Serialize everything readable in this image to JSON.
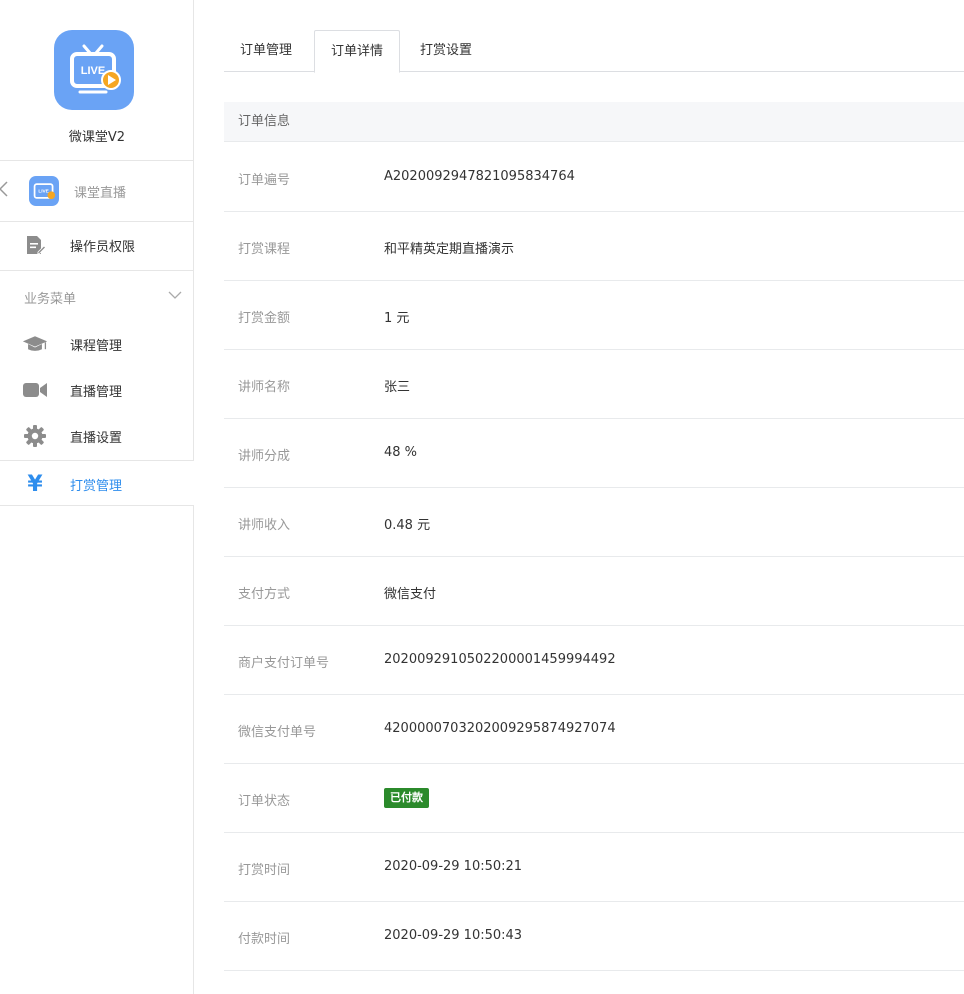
{
  "app": {
    "logo_icon": "live-tv-icon",
    "logo_text": "LIVE",
    "name": "微课堂V2",
    "accent": "#2e8ded",
    "logo_color": "#6aa3f5"
  },
  "sidebar": {
    "back": {
      "icon": "chevron-left-icon",
      "label": "课堂直播"
    },
    "permissions": {
      "icon": "document-edit-icon",
      "label": "操作员权限"
    },
    "group": {
      "title": "业务菜单",
      "icon": "chevron-down-icon"
    },
    "items": [
      {
        "icon": "graduation-cap-icon",
        "label": "课程管理",
        "active": false
      },
      {
        "icon": "video-camera-icon",
        "label": "直播管理",
        "active": false
      },
      {
        "icon": "gear-icon",
        "label": "直播设置",
        "active": false
      },
      {
        "icon": "yen-icon",
        "glyph": "¥",
        "label": "打赏管理",
        "active": true
      }
    ]
  },
  "tabs": [
    {
      "label": "订单管理",
      "active": false
    },
    {
      "label": "订单详情",
      "active": true
    },
    {
      "label": "打赏设置",
      "active": false
    }
  ],
  "section_title": "订单信息",
  "details": [
    {
      "key": "订单遍号",
      "value": "A20200929478210958347​64"
    },
    {
      "key": "打赏课程",
      "value": "和平精英定期直播演示"
    },
    {
      "key": "打赏金额",
      "value": "1 元"
    },
    {
      "key": "讲师名称",
      "value": "张三"
    },
    {
      "key": "讲师分成",
      "value": "48 %"
    },
    {
      "key": "讲师收入",
      "value": "0.48 元"
    },
    {
      "key": "支付方式",
      "value": "微信支付"
    },
    {
      "key": "商户支付订单号",
      "value": "2020092910502200001459994492"
    },
    {
      "key": "微信支付单号",
      "value": "4200000703202009295874927074"
    },
    {
      "key": "订单状态",
      "value": "已付款",
      "status_color": "#2b8a2b"
    },
    {
      "key": "打赏时间",
      "value": "2020-09-29 10:50:21"
    },
    {
      "key": "付款时间",
      "value": "2020-09-29 10:50:43"
    }
  ]
}
